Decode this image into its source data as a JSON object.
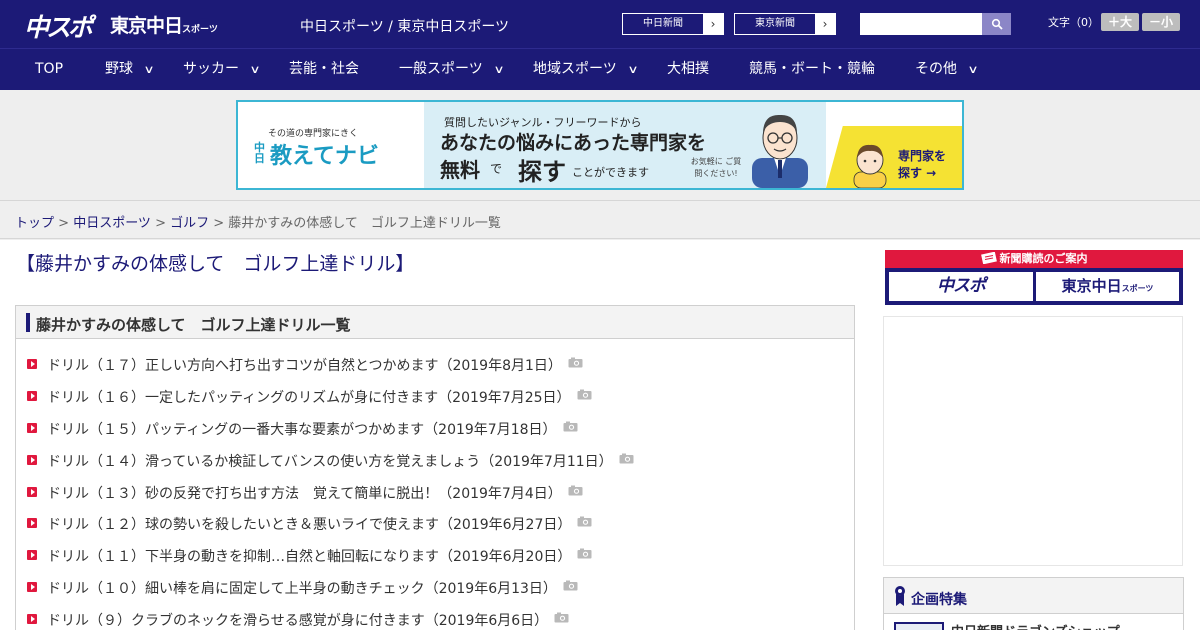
{
  "header": {
    "logo_chuspo": "中スポ",
    "logo_tokyo": "東京中日",
    "logo_tokyo_suffix": "スポーツ",
    "site_title": "中日スポーツ / 東京中日スポーツ",
    "sister_links": [
      {
        "label": "中日新聞",
        "arrow": "›"
      },
      {
        "label": "東京新聞",
        "arrow": "›"
      }
    ],
    "search": {
      "value": "",
      "placeholder": ""
    },
    "font_size_label": "文字（0）",
    "font_bigger": "＋大",
    "font_smaller": "－小"
  },
  "nav": {
    "items": [
      {
        "label": "TOP",
        "has_dropdown": false
      },
      {
        "label": "野球",
        "has_dropdown": true
      },
      {
        "label": "サッカー",
        "has_dropdown": true
      },
      {
        "label": "芸能・社会",
        "has_dropdown": false
      },
      {
        "label": "一般スポーツ",
        "has_dropdown": true
      },
      {
        "label": "地域スポーツ",
        "has_dropdown": true
      },
      {
        "label": "大相撲",
        "has_dropdown": false
      },
      {
        "label": "競馬・ボート・競輪",
        "has_dropdown": false
      },
      {
        "label": "その他",
        "has_dropdown": true
      }
    ],
    "chevron": "∨"
  },
  "banner": {
    "tagline": "その道の専門家にきく",
    "brand_small": "中日",
    "brand": "教えてナビ",
    "line1": "質問したいジャンル・フリーワードから",
    "line2": "あなたの悩みにあった専門家を",
    "line3a": "無料",
    "line3b": "で",
    "line3c": "探す",
    "line3d": "ことができます",
    "note": "お気軽に ご質問ください!",
    "cta": "専門家を 探す →"
  },
  "breadcrumb": {
    "items": [
      "トップ",
      "中日スポーツ",
      "ゴルフ"
    ],
    "separator": " > ",
    "current": "藤井かすみの体感して　ゴルフ上達ドリル一覧"
  },
  "page": {
    "title": "【藤井かすみの体感して　ゴルフ上達ドリル】",
    "list_heading": "藤井かすみの体感して　ゴルフ上達ドリル一覧",
    "articles": [
      "ドリル（１７）正しい方向へ打ち出すコツが自然とつかめます（2019年8月1日）",
      "ドリル（１６）一定したパッティングのリズムが身に付きます（2019年7月25日）",
      "ドリル（１５）パッティングの一番大事な要素がつかめます（2019年7月18日）",
      "ドリル（１４）滑っているか検証してバンスの使い方を覚えましょう（2019年7月11日）",
      "ドリル（１３）砂の反発で打ち出す方法　覚えて簡単に脱出！（2019年7月4日）",
      "ドリル（１２）球の勢いを殺したいとき＆悪いライで使えます（2019年6月27日）",
      "ドリル（１１）下半身の動きを抑制…自然と軸回転になります（2019年6月20日）",
      "ドリル（１０）細い棒を肩に固定して上半身の動きチェック（2019年6月13日）",
      "ドリル（９）クラブのネックを滑らせる感覚が身に付きます（2019年6月6日）"
    ]
  },
  "sidebar": {
    "subscribe_head": "新聞購読のご案内",
    "subscribe_chuspo": "中スポ",
    "subscribe_tokyo": "東京中日",
    "subscribe_tokyo_suffix": "スポーツ",
    "feature_title": "企画特集",
    "feature_item": "中日新聞ドラゴンズショップ"
  },
  "colors": {
    "brand_navy": "#1c1a77",
    "accent_red": "#e0183e",
    "banner_blue": "#3cb6d4"
  },
  "icons": [
    "search-icon",
    "chevron-right-icon",
    "chevron-down-icon",
    "camera-icon",
    "list-bullet-icon",
    "newspaper-icon",
    "ribbon-icon"
  ]
}
